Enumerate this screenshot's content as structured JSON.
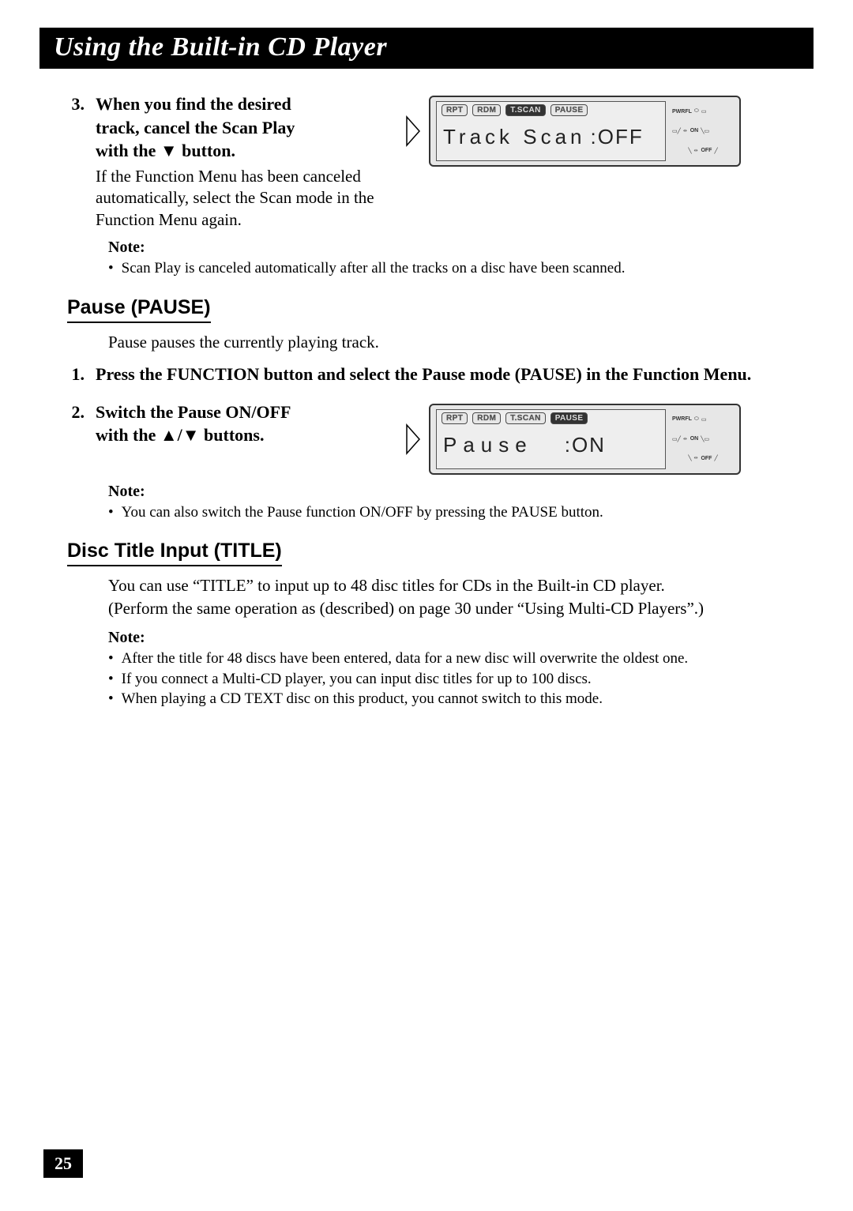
{
  "header": {
    "title": "Using the Built-in CD Player"
  },
  "step3": {
    "number": "3.",
    "title_l1": "When you find the desired",
    "title_l2": "track, cancel the Scan Play",
    "title_l3": "with the ▼ button.",
    "desc": "If the Function Menu has been canceled automatically, select the Scan mode in the Function Menu again."
  },
  "lcd1": {
    "ind": {
      "rpt": "RPT",
      "rdm": "RDM",
      "tscan": "T.SCAN",
      "pause": "PAUSE"
    },
    "text_label": "Track Scan",
    "text_value": ":OFF",
    "side": {
      "pwrfl": "PWRFL",
      "on": "ON",
      "off": "OFF"
    }
  },
  "note1": {
    "label": "Note:",
    "b1": "Scan Play is canceled automatically after all the tracks on a disc have been scanned."
  },
  "pause": {
    "heading": "Pause (PAUSE)",
    "desc": "Pause pauses the currently playing track.",
    "step1_num": "1.",
    "step1_title": "Press the FUNCTION button and select the Pause mode (PAUSE) in the Function Menu.",
    "step2_num": "2.",
    "step2_title_l1": "Switch the Pause ON/OFF",
    "step2_title_l2": "with the ▲/▼ buttons."
  },
  "lcd2": {
    "ind": {
      "rpt": "RPT",
      "rdm": "RDM",
      "tscan": "T.SCAN",
      "pause": "PAUSE"
    },
    "text_label": "Pause",
    "text_value": ":ON",
    "side": {
      "pwrfl": "PWRFL",
      "on": "ON",
      "off": "OFF"
    }
  },
  "note2": {
    "label": "Note:",
    "b1": "You can also switch the Pause function ON/OFF by pressing the PAUSE button."
  },
  "title": {
    "heading": "Disc Title Input (TITLE)",
    "desc_l1": "You can use “TITLE” to input up to 48 disc titles for CDs in the Built-in CD player.",
    "desc_l2": "(Perform the same operation as (described) on page 30 under “Using Multi-CD Players”.)"
  },
  "note3": {
    "label": "Note:",
    "b1": "After the title for 48 discs have been entered, data for a new disc will overwrite the oldest one.",
    "b2": "If you connect a Multi-CD player, you can input disc titles for up to 100 discs.",
    "b3": "When playing a CD TEXT disc on this product, you cannot switch to this mode."
  },
  "page_number": "25"
}
